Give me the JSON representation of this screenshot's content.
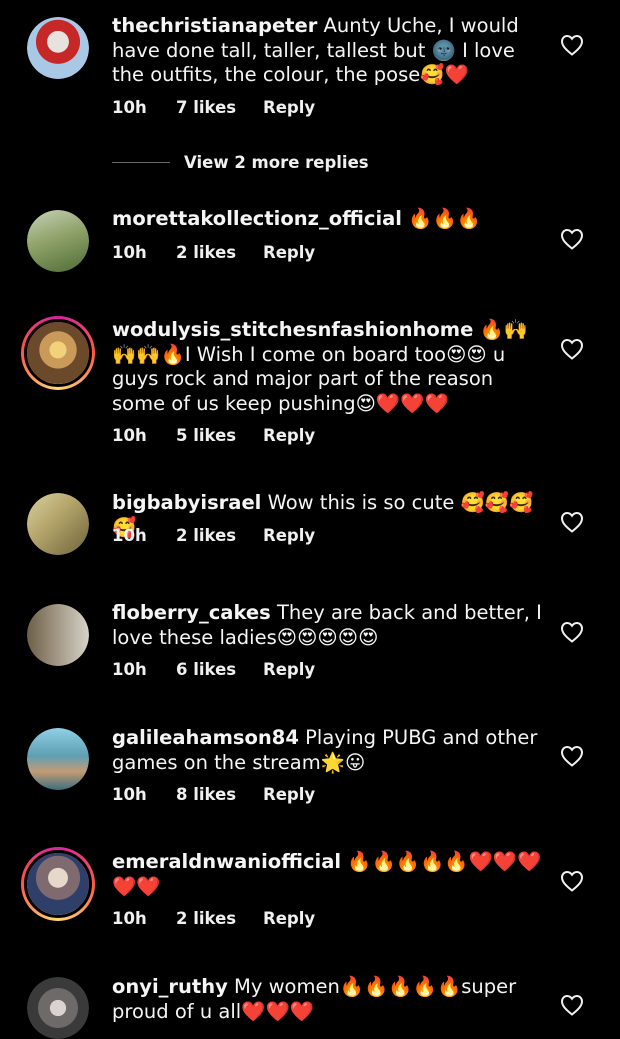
{
  "comments": [
    {
      "username": "thechristianapeter",
      "text": "Aunty Uche, I would have done tall, taller, tallest but 🌚 I love the outfits, the colour, the pose🥰❤️",
      "time": "10h",
      "likes": "7 likes",
      "reply": "Reply",
      "avatar_color": "#a9c8e6"
    },
    {
      "username": "morettakollectionz_official",
      "text": "🔥🔥🔥",
      "time": "10h",
      "likes": "2 likes",
      "reply": "Reply",
      "avatar_color": "#8fa36a"
    },
    {
      "username": "wodulysis_stitchesnfashionhome",
      "text": "🔥🙌🙌🙌🔥I Wish I come on board too😍😍 u guys rock and major part of the reason some of us keep pushing😍❤️❤️❤️",
      "time": "10h",
      "likes": "5 likes",
      "reply": "Reply",
      "avatar_color": "#c99a5a"
    },
    {
      "username": "bigbabyisrael",
      "text": "Wow this is so cute 🥰🥰🥰🥰",
      "time": "10h",
      "likes": "2 likes",
      "reply": "Reply",
      "avatar_color": "#b7a86e"
    },
    {
      "username": "floberry_cakes",
      "text": "They are back and better, I love these ladies😍😍😍😍😍",
      "time": "10h",
      "likes": "6 likes",
      "reply": "Reply",
      "avatar_color": "#9a8e7a"
    },
    {
      "username": "galileahamson84",
      "text": "Playing PUBG and other games on the stream🌟😛",
      "time": "10h",
      "likes": "8 likes",
      "reply": "Reply",
      "avatar_color": "#5f9fb3"
    },
    {
      "username": "emeraldnwaniofficial",
      "text": "🔥🔥🔥🔥🔥❤️❤️❤️❤️❤️",
      "time": "10h",
      "likes": "2 likes",
      "reply": "Reply",
      "avatar_color": "#7f6b6f"
    },
    {
      "username": "onyi_ruthy",
      "text": "My women🔥🔥🔥🔥🔥super proud of u all❤️❤️❤️",
      "time": "",
      "likes": "",
      "reply": "",
      "avatar_color": "#6e6a6a"
    }
  ],
  "view_more_replies": "View 2 more replies",
  "icons": {
    "like": "heart-outline-icon"
  }
}
